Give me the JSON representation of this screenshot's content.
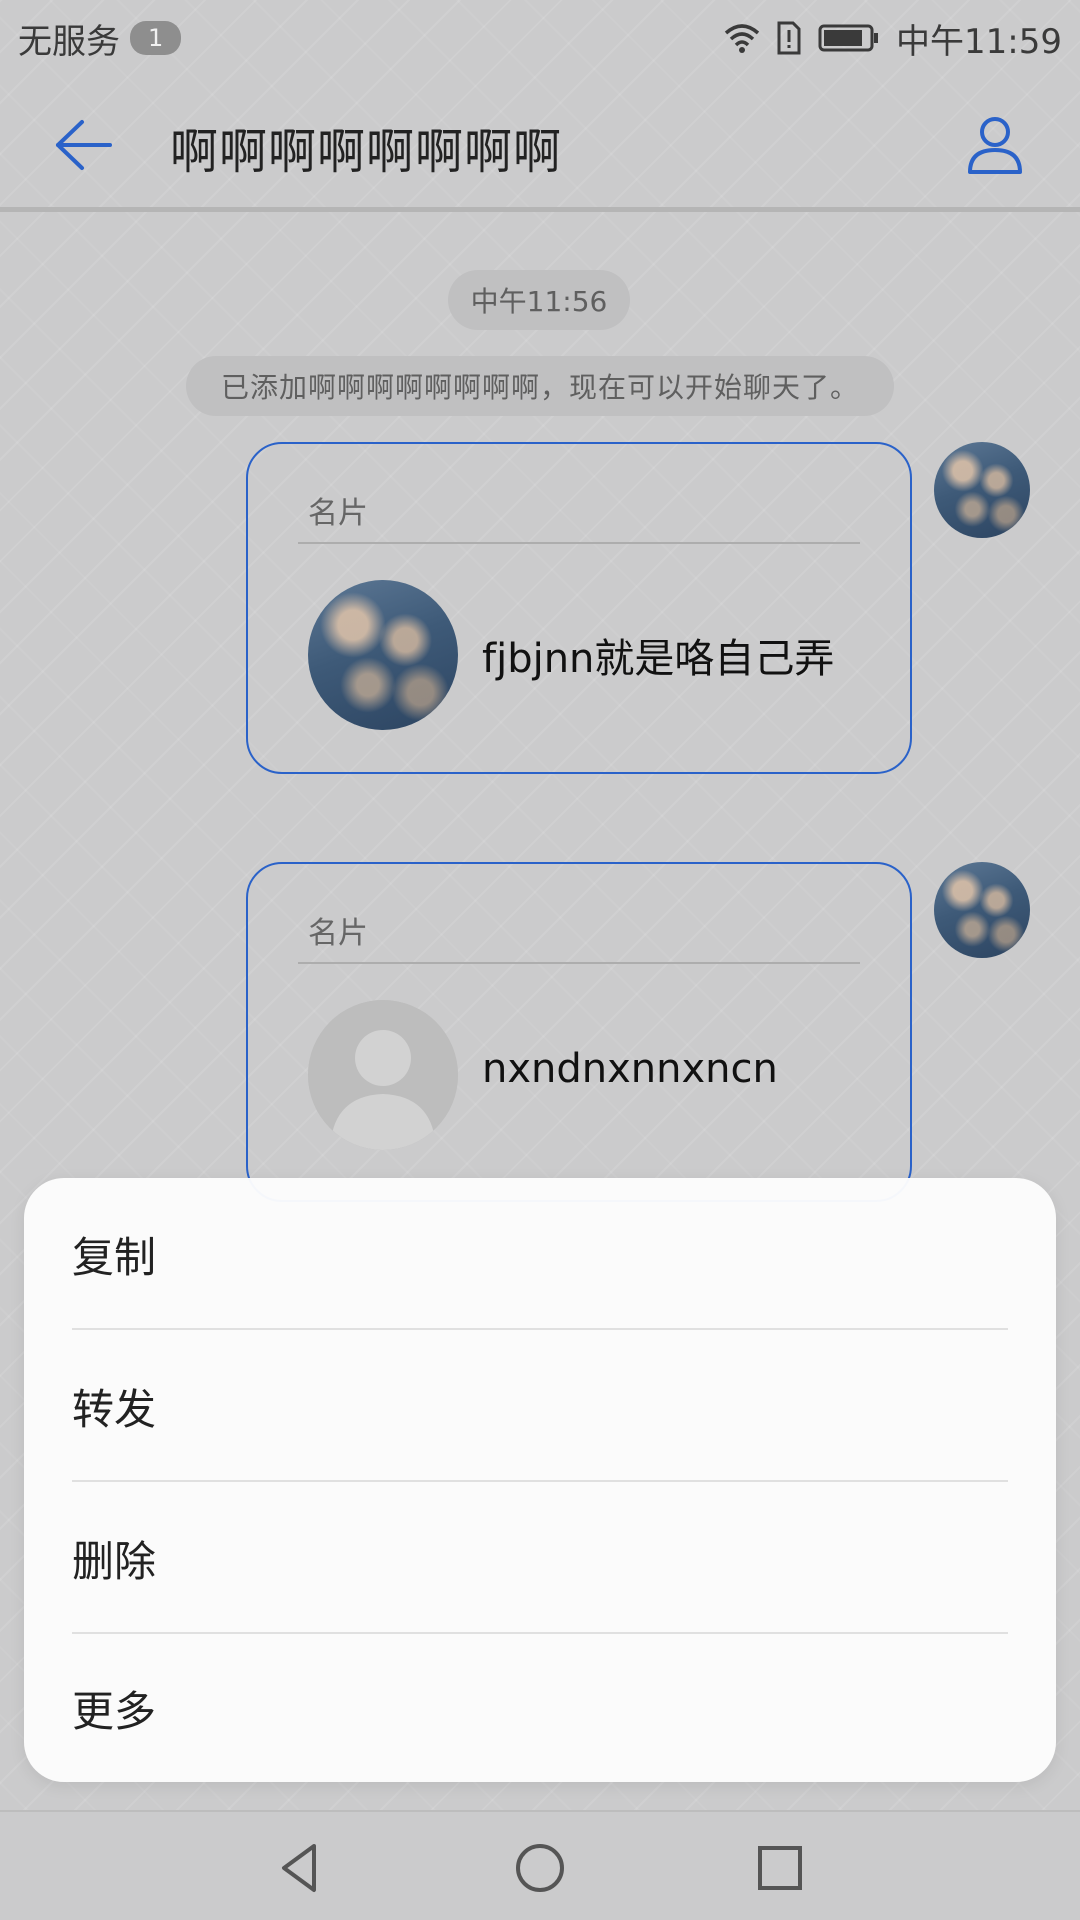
{
  "status_bar": {
    "carrier": "无服务",
    "sim_badge": "1",
    "time": "中午11:59"
  },
  "header": {
    "title": "啊啊啊啊啊啊啊啊",
    "back_icon": "arrow-left-icon",
    "contact_icon": "person-icon",
    "accent_color": "#2a62c9"
  },
  "chat": {
    "time_label": "中午11:56",
    "system_note": "已添加啊啊啊啊啊啊啊啊，现在可以开始聊天了。",
    "cards": [
      {
        "label": "名片",
        "name": "fjbjnn就是咯自己弄"
      },
      {
        "label": "名片",
        "name": "nxndnxnnxncn"
      }
    ]
  },
  "context_menu": {
    "items": [
      {
        "label": "复制"
      },
      {
        "label": "转发"
      },
      {
        "label": "删除"
      },
      {
        "label": "更多"
      }
    ]
  },
  "nav_bar": {
    "back": "triangle-back-icon",
    "home": "circle-home-icon",
    "recents": "square-recents-icon"
  }
}
